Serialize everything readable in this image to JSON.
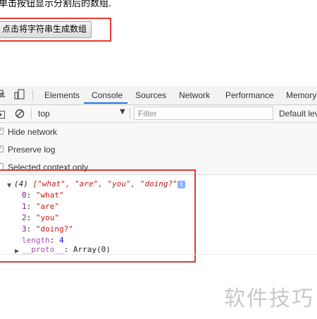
{
  "page": {
    "intro_text": "单击按钮显示分割后的数组.",
    "button_label": "点击将字符串生成数组"
  },
  "devtools": {
    "tabs": [
      {
        "label": "Elements",
        "active": false
      },
      {
        "label": "Console",
        "active": true
      },
      {
        "label": "Sources",
        "active": false
      },
      {
        "label": "Network",
        "active": false
      },
      {
        "label": "Performance",
        "active": false
      },
      {
        "label": "Memory",
        "active": false
      }
    ],
    "context_select": "top",
    "filter_placeholder": "Filter",
    "levels_label": "Default lev",
    "settings": [
      {
        "label": "Hide network",
        "checked": true
      },
      {
        "label": "Preserve log",
        "checked": true
      },
      {
        "label": "Selected context only",
        "checked": false
      }
    ],
    "console": {
      "summary_count": "(4)",
      "summary_array": "[\"what\", \"are\", \"you\", \"doing?\"]",
      "entries": [
        {
          "key": "0",
          "value": "\"what\""
        },
        {
          "key": "1",
          "value": "\"are\""
        },
        {
          "key": "2",
          "value": "\"you\""
        },
        {
          "key": "3",
          "value": "\"doing?\""
        }
      ],
      "length_key": "length",
      "length_value": "4",
      "proto_key": "__proto__",
      "proto_value": "Array(0)"
    }
  },
  "watermark": "软件技巧",
  "colors": {
    "highlight_red": "#e53935",
    "active_tab_blue": "#1a73e8",
    "key_purple": "#881391",
    "string_red": "#c41a16",
    "number_blue": "#1c00cf"
  },
  "icons": [
    "inspect-icon",
    "device-toolbar-icon",
    "console-sidebar-icon",
    "clear-console-icon",
    "dropdown-arrow-icon",
    "expand-triangle-icon",
    "collapse-triangle-icon",
    "info-icon",
    "checkbox-icon"
  ]
}
